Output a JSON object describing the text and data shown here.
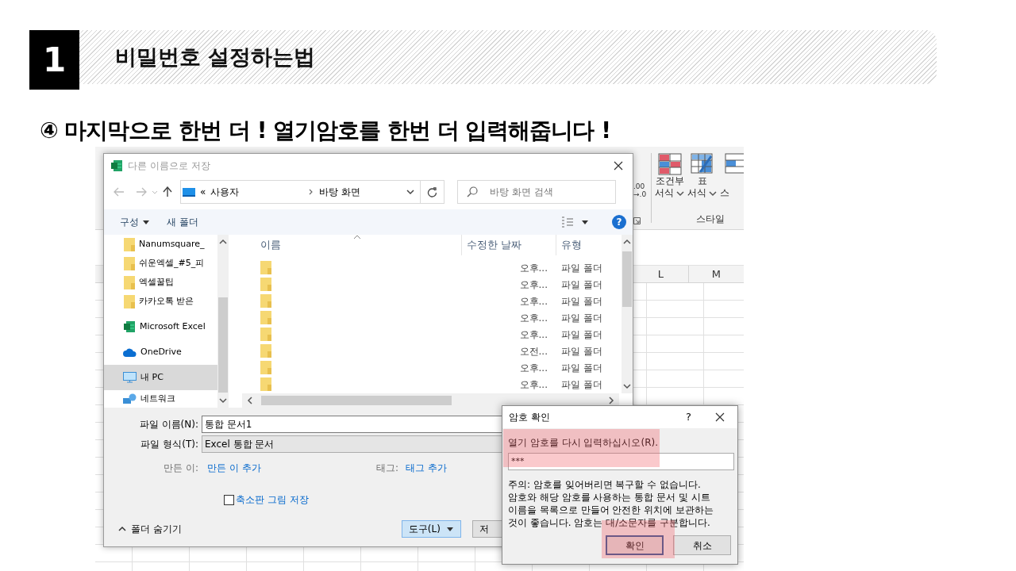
{
  "slide": {
    "number": "1",
    "title": "비밀번호 설정하는법",
    "step": "④ 마지막으로 한번 더 ! 열기암호를 한번 더 입력해줍니다 !"
  },
  "excel": {
    "decimal_top": ".00",
    "decimal_bottom": "→.0",
    "group_label": "스타일",
    "columns": [
      "L",
      "M"
    ],
    "ribbon_buttons": [
      {
        "kind": "conditional",
        "label": "조건부",
        "sublabel": "서식",
        "dropdown": true
      },
      {
        "kind": "table",
        "label": "표",
        "sublabel": "서식",
        "dropdown": true
      },
      {
        "kind": "cell",
        "sublabel": "스",
        "dropdown": false
      }
    ]
  },
  "save_dialog": {
    "title": "다른 이름으로 저장",
    "address": {
      "prefix": "«",
      "segments": [
        "사용자",
        "바탕 화면"
      ]
    },
    "search_placeholder": "바탕 화면 검색",
    "toolbar": [
      {
        "label": "구성",
        "dropdown": true
      },
      {
        "label": "새 폴더",
        "dropdown": false
      }
    ],
    "help": "?",
    "nav_items": [
      {
        "kind": "folder",
        "label": "Nanumsquare_",
        "selected": false
      },
      {
        "kind": "folder",
        "label": "쉬운엑셀_#5_피",
        "selected": false
      },
      {
        "kind": "folder",
        "label": "엑셀꿀팁",
        "selected": false
      },
      {
        "kind": "folder",
        "label": "카카오톡 받은",
        "selected": false
      },
      {
        "kind": "excel",
        "label": "Microsoft Excel",
        "selected": false
      },
      {
        "kind": "cloud",
        "label": "OneDrive",
        "selected": false
      },
      {
        "kind": "pc",
        "label": "내 PC",
        "selected": true
      },
      {
        "kind": "network",
        "label": "네트워크",
        "selected": false
      }
    ],
    "columns": [
      "이름",
      "수정한 날짜",
      "유형"
    ],
    "rows": [
      {
        "modified": "오후...",
        "type": "파일 폴더"
      },
      {
        "modified": "오후...",
        "type": "파일 폴더"
      },
      {
        "modified": "오후...",
        "type": "파일 폴더"
      },
      {
        "modified": "오후...",
        "type": "파일 폴더"
      },
      {
        "modified": "오후...",
        "type": "파일 폴더"
      },
      {
        "modified": "오전...",
        "type": "파일 폴더"
      },
      {
        "modified": "오후...",
        "type": "파일 폴더"
      },
      {
        "modified": "오후...",
        "type": "파일 폴더"
      }
    ],
    "filename_label": "파일 이름(N):",
    "filename": "통합 문서1",
    "filetype_label": "파일 형식(T):",
    "filetype": "Excel 통합 문서",
    "author_label": "만든 이:",
    "author_link": "만든 이 추가",
    "tags_label": "태그:",
    "tags_link": "태그 추가",
    "thumbnail": {
      "label": "축소판 그림 저장",
      "checked": false
    },
    "hide_folders": "폴더 숨기기",
    "buttons": [
      {
        "kind": "split",
        "label": "도구(L)"
      },
      {
        "kind": "plain",
        "label": "저"
      }
    ]
  },
  "password_dialog": {
    "title": "암호 확인",
    "help": "?",
    "prompt": "열기 암호를 다시 입력하십시오(R).",
    "prompt_highlight": true,
    "value": "***",
    "note": "주의: 암호를 잊어버리면 복구할 수 없습니다. 암호와 해당 암호를 사용하는 통합 문서 및 시트 이름을 목록으로 만들어 안전한 위치에 보관하는 것이 좋습니다. 암호는 대/소문자를 구분합니다.",
    "buttons": [
      {
        "label": "확인",
        "default": true,
        "highlight": true
      },
      {
        "label": "취소",
        "default": false,
        "highlight": false
      }
    ]
  }
}
